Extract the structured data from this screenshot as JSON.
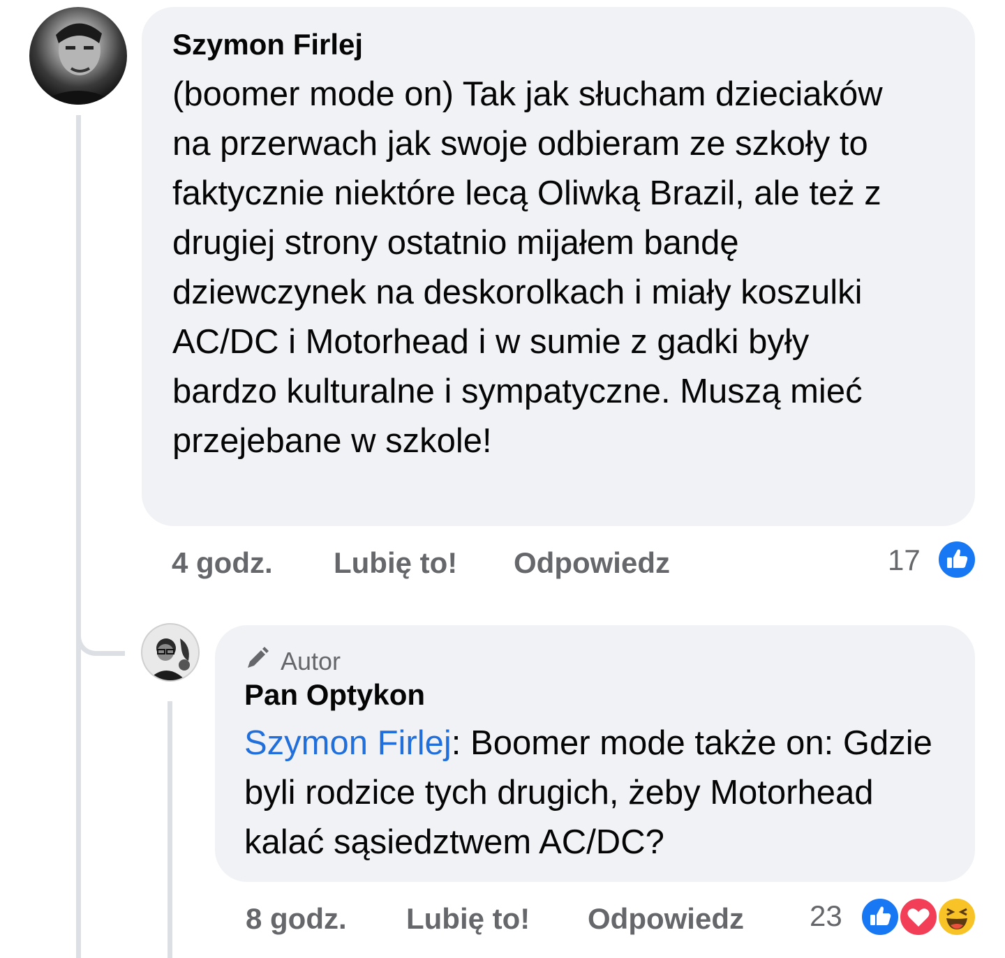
{
  "comment": {
    "author": "Szymon Firlej",
    "text": "(boomer mode on) Tak jak słucham dzieciaków na przerwach jak swoje odbieram ze szkoły to faktycznie niektóre lecą Oliwką Brazil, ale też z drugiej strony ostatnio mijałem bandę dziewczynek na deskorolkach i miały koszulki AC/DC i Motorhead i w sumie z gadki były bardzo kulturalne i sympatyczne. Muszą mieć przejebane w szkole!",
    "time": "4 godz.",
    "like_label": "Lubię to!",
    "reply_label": "Odpowiedz",
    "reaction_count": "17",
    "reaction_icons": [
      "like-icon"
    ]
  },
  "reply": {
    "badge": "Autor",
    "badge_icon": "pencil-icon",
    "author": "Pan Optykon",
    "mention": "Szymon Firlej",
    "text": ": Boomer mode także on: Gdzie byli rodzice tych drugich, żeby Motorhead kalać sąsiedztwem AC/DC?",
    "time": "8 godz.",
    "like_label": "Lubię to!",
    "reply_label": "Odpowiedz",
    "reaction_count": "23",
    "reaction_icons": [
      "like-icon",
      "love-icon",
      "haha-icon"
    ]
  },
  "colors": {
    "bubble": "#f0f2f5",
    "link": "#216fdb",
    "secondary_text": "#65676b",
    "like": "#1877f2",
    "love": "#f33e58"
  }
}
